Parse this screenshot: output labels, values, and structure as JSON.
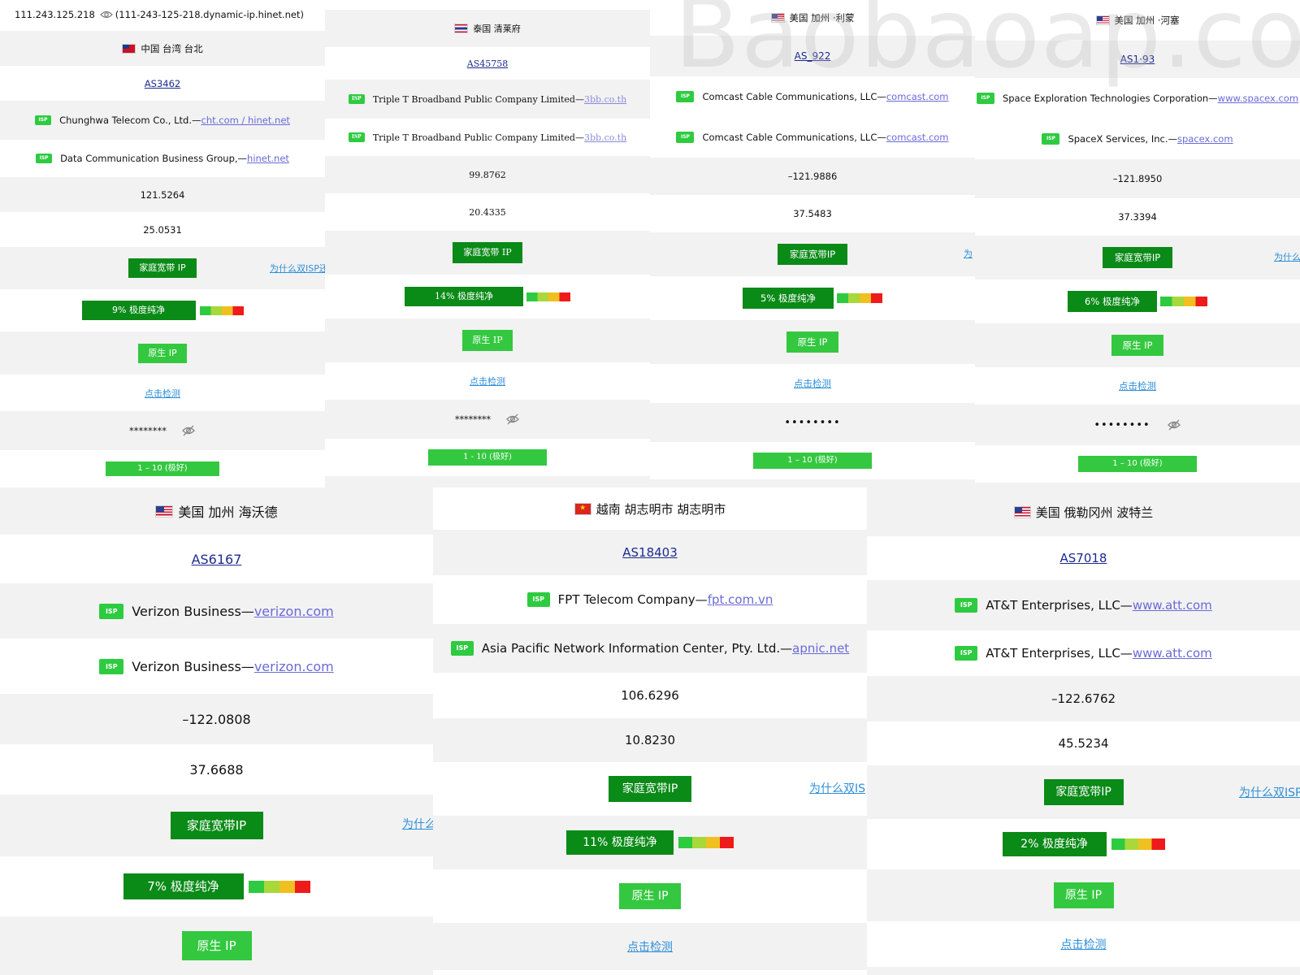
{
  "panel1": {
    "ip_line": "111.243.125.218",
    "host_line": "(111-243-125-218.dynamic-ip.hinet.net)",
    "location": "中国 台湾 台北",
    "asn": "AS3462",
    "isp1_name": "Chunghwa Telecom Co., Ltd.—",
    "isp1_domain": "cht.com / hinet.net",
    "isp2_name": "Data Communication Business Group,—",
    "isp2_domain": "hinet.net",
    "longitude": "121.5264",
    "latitude": "25.0531",
    "type_label": "家庭宽带 IP",
    "why_label": "为什么双ISP还",
    "purity_label": "9%  极度纯净",
    "native_label": "原生 IP",
    "check_label": "点击检测",
    "masked": "********",
    "score_label": "1 – 10 (极好)"
  },
  "panel2": {
    "location": "泰国 清莱府",
    "asn": "AS45758",
    "isp1_name": "Triple T Broadband Public Company Limited—",
    "isp1_domain": "3bb.co.th",
    "isp2_name": "Triple T Broadband Public Company Limited—",
    "isp2_domain": "3bb.co.th",
    "longitude": "99.8762",
    "latitude": "20.4335",
    "type_label": "家庭宽带 IP",
    "purity_label": "14%  极度纯净",
    "native_label": "原生 IP",
    "check_label": "点击检测",
    "masked": "********",
    "score_label": "1 - 10 (极好)"
  },
  "panel3": {
    "location": "美国 加州 ·利蒙",
    "asn": "AS_922",
    "isp1_name": "Comcast Cable Communications, LLC—",
    "isp1_domain": "comcast.com",
    "isp2_name": "Comcast Cable Communications, LLC—",
    "isp2_domain": "comcast.com",
    "longitude": "–121.9886",
    "latitude": "37.5483",
    "type_label": "家庭宽带IP",
    "why_label": "为",
    "purity_label": "5%  极度纯净",
    "native_label": "原生 IP",
    "check_label": "点击检测",
    "masked": "••••••••",
    "score_label": "1 – 10 (极好)"
  },
  "panel4": {
    "location": "美国 加州 ·河塞",
    "asn": "AS1·93",
    "isp1_name": "Space Exploration Technologies Corporation—",
    "isp1_domain": "www.spacex.com",
    "isp2_name": "SpaceX Services, Inc.—",
    "isp2_domain": "spacex.com",
    "longitude": "–121.8950",
    "latitude": "37.3394",
    "type_label": "家庭宽带IP",
    "why_label": "为什么",
    "purity_label": "6%  极度纯净",
    "native_label": "原生 IP",
    "check_label": "点击检测",
    "masked": "••••••••",
    "score_label": "1 – 10 (极好)"
  },
  "panel5": {
    "location": "美国 加州 海沃德",
    "asn": "AS6167",
    "isp1_name": "Verizon Business—",
    "isp1_domain": "verizon.com",
    "isp2_name": "Verizon Business—",
    "isp2_domain": "verizon.com",
    "longitude": "–122.0808",
    "latitude": "37.6688",
    "type_label": "家庭宽带IP",
    "why_label": "为什么",
    "purity_label": "7%  极度纯净",
    "native_label": "原生 IP"
  },
  "panel6": {
    "location": "越南 胡志明市 胡志明市",
    "asn": "AS18403",
    "isp1_name": "FPT Telecom Company—",
    "isp1_domain": "fpt.com.vn",
    "isp2_name": "Asia Pacific Network Information Center, Pty. Ltd.—",
    "isp2_domain": "apnic.net",
    "longitude": "106.6296",
    "latitude": "10.8230",
    "type_label": "家庭宽带IP",
    "why_label": "为什么双IS",
    "purity_label": "11%  极度纯净",
    "native_label": "原生 IP",
    "check_label": "点击检测"
  },
  "panel7": {
    "location": "美国 俄勒冈州 波特兰",
    "asn": "AS7018",
    "isp1_name": "AT&T Enterprises, LLC—",
    "isp1_domain": "www.att.com",
    "isp2_name": "AT&T Enterprises, LLC—",
    "isp2_domain": "www.att.com",
    "longitude": "–122.6762",
    "latitude": "45.5234",
    "type_label": "家庭宽带IP",
    "why_label": "为什么双ISP",
    "purity_label": "2%  极度纯净",
    "native_label": "原生 IP",
    "check_label": "点击检测"
  },
  "common": {
    "isp_badge": "ISP"
  },
  "watermark": "Baobaoap.com",
  "colors": {
    "dark_green": "#0a8a17",
    "light_green": "#34c840",
    "isp_badge": "#2ecb40",
    "asn_link": "#1d2b8f",
    "domain_link": "#6a6ad8",
    "why_link": "#2d8fd8",
    "row_gray": "#f2f2f2"
  },
  "icons": [
    "eye-icon",
    "eye-slash-icon",
    "flag-tw-icon",
    "flag-th-icon",
    "flag-us-icon",
    "flag-vn-icon"
  ]
}
